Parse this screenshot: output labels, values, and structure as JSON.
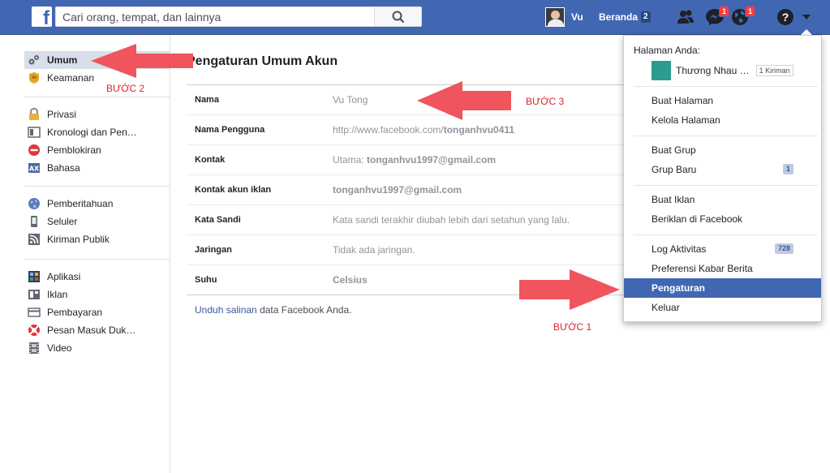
{
  "topbar": {
    "search_placeholder": "Cari orang, tempat, dan lainnya",
    "user_name": "Vu",
    "home_label": "Beranda",
    "home_count": "2",
    "messages_badge": "1",
    "notifications_badge": "1"
  },
  "sidebar": {
    "group1": [
      {
        "label": "Umum",
        "icon": "gear-icon",
        "active": true
      },
      {
        "label": "Keamanan",
        "icon": "shield-icon"
      }
    ],
    "group2": [
      {
        "label": "Privasi",
        "icon": "lock-icon"
      },
      {
        "label": "Kronologi dan Pen…",
        "icon": "timeline-icon"
      },
      {
        "label": "Pemblokiran",
        "icon": "block-icon"
      },
      {
        "label": "Bahasa",
        "icon": "language-icon"
      }
    ],
    "group3": [
      {
        "label": "Pemberitahuan",
        "icon": "globe-icon"
      },
      {
        "label": "Seluler",
        "icon": "mobile-icon"
      },
      {
        "label": "Kiriman Publik",
        "icon": "rss-icon"
      }
    ],
    "group4": [
      {
        "label": "Aplikasi",
        "icon": "apps-icon"
      },
      {
        "label": "Iklan",
        "icon": "ads-icon"
      },
      {
        "label": "Pembayaran",
        "icon": "card-icon"
      },
      {
        "label": "Pesan Masuk Duk…",
        "icon": "lifebuoy-icon"
      },
      {
        "label": "Video",
        "icon": "film-icon"
      }
    ]
  },
  "main": {
    "title": "Pengaturan Umum Akun",
    "rows": [
      {
        "label": "Nama",
        "value": "Vu Tong"
      },
      {
        "label": "Nama Pengguna",
        "value_prefix": "http://www.facebook.com/",
        "value_strong": "tonganhvu0411"
      },
      {
        "label": "Kontak",
        "value_prefix": "Utama: ",
        "value_strong": "tonganhvu1997@gmail.com"
      },
      {
        "label": "Kontak akun iklan",
        "value_prefix": "",
        "value_strong": "tonganhvu1997@gmail.com"
      },
      {
        "label": "Kata Sandi",
        "value": "Kata sandi terakhir diubah lebih dari setahun yang lalu."
      },
      {
        "label": "Jaringan",
        "value": "Tidak ada jaringan."
      },
      {
        "label": "Suhu",
        "value_prefix": "",
        "value_strong": "Celsius"
      }
    ],
    "footer_link": "Unduh salinan",
    "footer_text": " data Facebook Anda."
  },
  "dropdown": {
    "heading": "Halaman Anda:",
    "page_name": "Thương Nhau …",
    "page_badge": "1 Kiriman",
    "items": [
      {
        "label": "Buat Halaman"
      },
      {
        "label": "Kelola Halaman"
      },
      {
        "label": "Buat Grup"
      },
      {
        "label": "Grup Baru",
        "count": "1"
      },
      {
        "label": "Buat Iklan"
      },
      {
        "label": "Beriklan di Facebook"
      },
      {
        "label": "Log Aktivitas",
        "count": "728"
      },
      {
        "label": "Preferensi Kabar Berita"
      },
      {
        "label": "Pengaturan",
        "selected": true
      },
      {
        "label": "Keluar"
      }
    ]
  },
  "annotations": {
    "step1": "BƯỚC 1",
    "step2": "BƯỚC 2",
    "step3": "BƯỚC 3",
    "arrow_color": "#f0545c"
  }
}
